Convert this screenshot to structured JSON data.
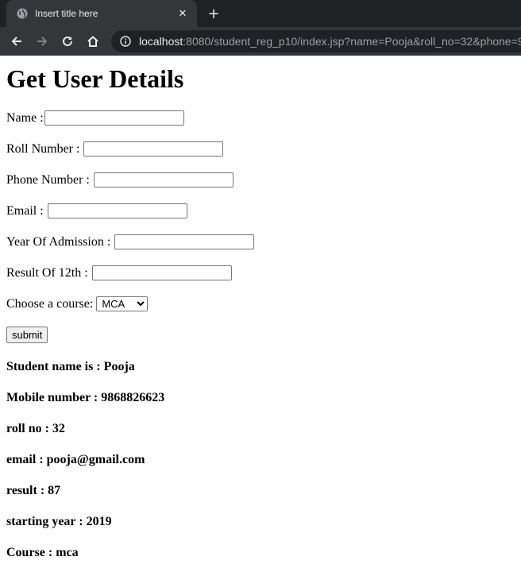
{
  "browser": {
    "tab_title": "Insert title here",
    "url_host": "localhost",
    "url_rest": ":8080/student_reg_p10/index.jsp?name=Pooja&roll_no=32&phone=9"
  },
  "page": {
    "heading": "Get User Details",
    "fields": {
      "name_label": "Name :",
      "roll_label": "Roll Number :",
      "phone_label": "Phone Number :",
      "email_label": "Email :",
      "year_label": "Year Of Admission :",
      "result_label": "Result Of 12th :",
      "course_label": "Choose a course:",
      "course_selected": "MCA"
    },
    "submit_label": "submit",
    "results": [
      "Student name is : Pooja",
      "Mobile number : 9868826623",
      "roll no : 32",
      "email : pooja@gmail.com",
      "result : 87",
      "starting year : 2019",
      "Course : mca"
    ]
  }
}
